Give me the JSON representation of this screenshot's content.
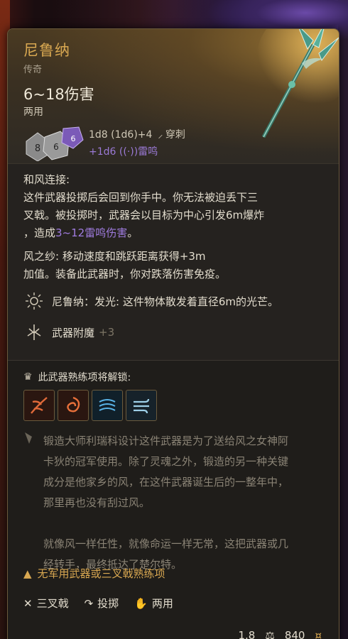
{
  "item": {
    "name": "尼鲁纳",
    "rarity": "传奇",
    "damage": "6~18伤害",
    "handedness": "两用",
    "roll_main": "1d8 (1d6)+4",
    "roll_main_type": "穿刺",
    "roll_extra": "+1d6",
    "roll_extra_type": "雷鸣"
  },
  "abilities": {
    "a1_title": "和风连接:",
    "a1_text1": "这件武器投掷后会回到你手中。你无法被迫丢下三",
    "a1_text2": "叉戟。被投掷时，武器会以目标为中心引发6m爆炸",
    "a1_text3_pre": "，造成",
    "a1_text3_hl": "3~12雷鸣伤害",
    "a1_text3_post": "。",
    "a2_line1": "风之纱: 移动速度和跳跃距离获得+3m",
    "a2_line2": "加值。装备此武器时，你对跌落伤害免疫。",
    "light_label": "尼鲁纳：发光: 这件物体散发着直径6m的光芒。",
    "enchant_label": "武器附魔",
    "enchant_value": "+3"
  },
  "proficiency": {
    "unlock_label": "此武器熟练项将解锁:",
    "skills": [
      "skill-fire-slash-icon",
      "skill-fire-swirl-icon",
      "skill-lightning-icon",
      "skill-wind-icon"
    ]
  },
  "lore": {
    "l1": "锻造大师利瑞科设计这件武器是为了送给风之女神阿",
    "l2": "卡狄的冠军使用。除了灵魂之外，锻造的另一种关键",
    "l3": "成分是他家乡的风，在这件武器诞生后的一整年中，",
    "l4": "那里再也没有刮过风。",
    "l5": "就像风一样任性，就像命运一样无常，这把武器或几",
    "l6": "经转手，最终抵达了楚尔特。"
  },
  "warning": "无军用武器或三叉戟熟练项",
  "properties": {
    "weapon_type": "三叉戟",
    "thrown": "投掷",
    "versatile": "两用"
  },
  "footer": {
    "weight": "1.8",
    "value": "840"
  },
  "colors": {
    "title_gold": "#d9a851",
    "thunder_purple": "#a07ce0",
    "warning": "#d9a851"
  }
}
